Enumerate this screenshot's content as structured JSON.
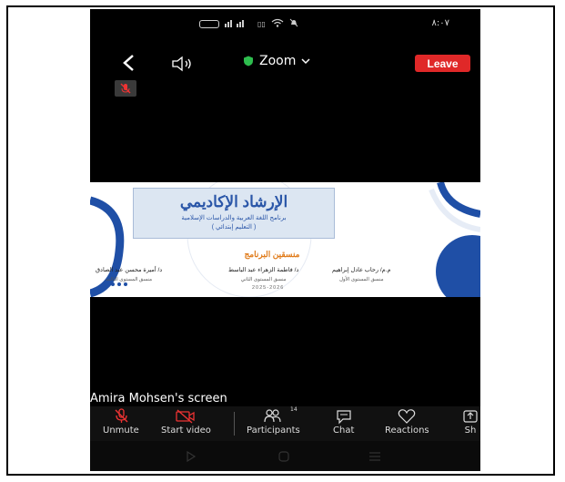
{
  "status": {
    "time": "٨:٠٧"
  },
  "topbar": {
    "app_title": "Zoom",
    "leave_label": "Leave"
  },
  "slide": {
    "title": "الإرشاد الإكاديمي",
    "subtitle": "برنامج اللغة العربية والدراسات الإسلامية",
    "subtitle2": "( التعليم إبتدائي )",
    "coordinators_title": "منسقين البرنامج",
    "people": [
      {
        "name": "م.م/ رحاب عادل إبراهيم",
        "role": "منسق المستوى الأول"
      },
      {
        "name": "د/ فاطمة الزهراء عبد الباسط",
        "role": "منسق المستوى الثاني"
      },
      {
        "name": "د/ أميرة محسن عبد الصادق",
        "role": "منسق المستوى الثالث"
      }
    ],
    "year": "2025-2026"
  },
  "share_label": "Amira Mohsen's screen",
  "toolbar": {
    "unmute": "Unmute",
    "start_video": "Start video",
    "participants": "Participants",
    "participants_count": "14",
    "chat": "Chat",
    "reactions": "Reactions",
    "share": "Sh"
  }
}
